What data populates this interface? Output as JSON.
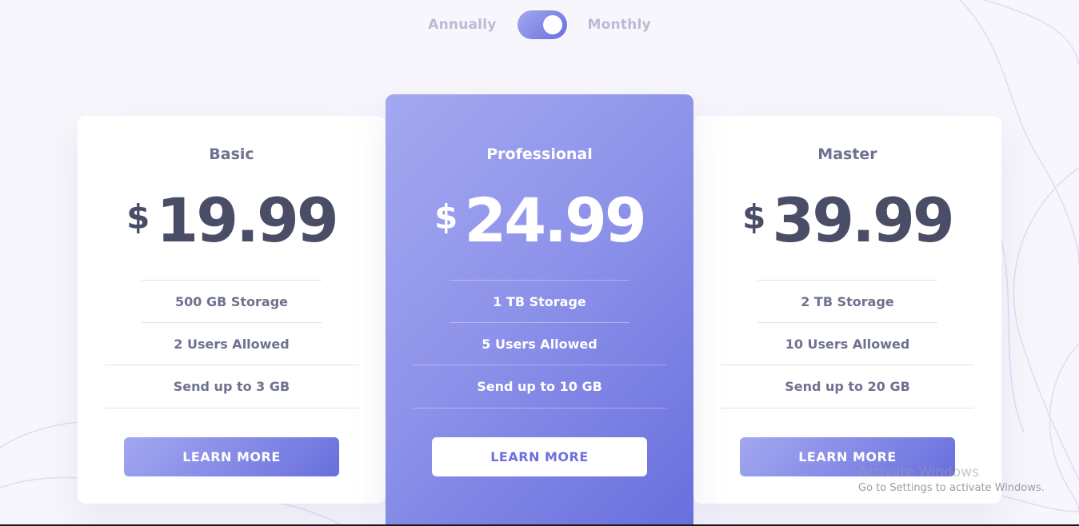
{
  "toggle": {
    "left_label": "Annually",
    "right_label": "Monthly",
    "selected": "Monthly"
  },
  "plans": [
    {
      "name": "Basic",
      "currency": "$",
      "price": "19.99",
      "features": [
        "500 GB Storage",
        "2 Users Allowed",
        "Send up to 3 GB"
      ],
      "button": "LEARN MORE"
    },
    {
      "name": "Professional",
      "currency": "$",
      "price": "24.99",
      "features": [
        "1 TB Storage",
        "5 Users Allowed",
        "Send up to 10 GB"
      ],
      "button": "LEARN MORE"
    },
    {
      "name": "Master",
      "currency": "$",
      "price": "39.99",
      "features": [
        "2 TB Storage",
        "10 Users Allowed",
        "Send up to 20 GB"
      ],
      "button": "LEARN MORE"
    }
  ],
  "watermark": {
    "title": "Activate Windows",
    "subtitle": "Go to Settings to activate Windows."
  },
  "colors": {
    "accent_light": "#a3a8f0",
    "accent_dark": "#696fdd",
    "text": "#4a4d66",
    "muted": "#6e728e"
  }
}
